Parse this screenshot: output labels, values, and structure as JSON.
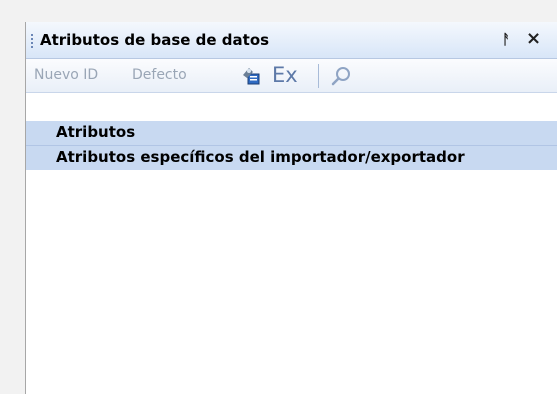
{
  "panel": {
    "title": "Atributos de base de datos",
    "pin_glyph": "ᚨ",
    "close_glyph": "×"
  },
  "toolbar": {
    "nuevo_id": "Nuevo ID",
    "defecto": "Defecto",
    "ex": "Ex",
    "icons": [
      "database-key-icon",
      "search-icon"
    ]
  },
  "list": {
    "items": [
      {
        "label": "Atributos"
      },
      {
        "label": "Atributos específicos del importador/exportador"
      }
    ]
  },
  "colors": {
    "header_bg": "#d8e6f8",
    "row_bg": "#c8d9f1",
    "disabled_text": "#9aa6b6",
    "accent": "#5d79a8"
  }
}
